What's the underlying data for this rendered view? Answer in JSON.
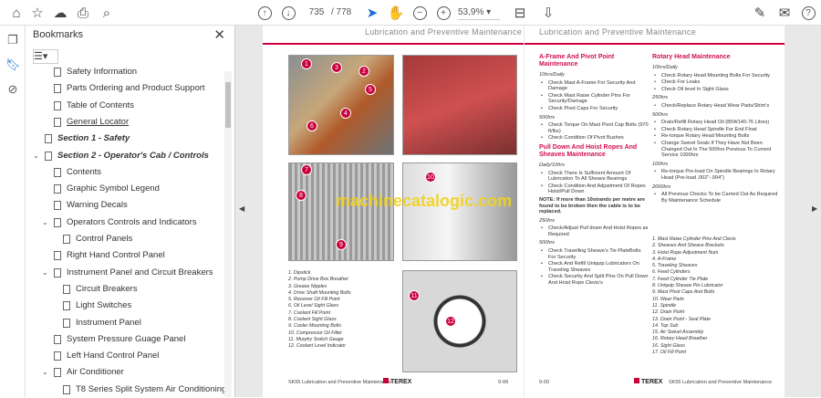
{
  "toolbar": {
    "current_page": "735",
    "total_pages": "/ 778",
    "zoom": "53,9%"
  },
  "bookmarks": {
    "title": "Bookmarks",
    "items": [
      {
        "label": "Safety Information",
        "level": 2,
        "bold": false,
        "twisty": ""
      },
      {
        "label": "Parts Ordering and Product Support",
        "level": 2,
        "bold": false,
        "twisty": ""
      },
      {
        "label": "Table of Contents",
        "level": 2,
        "bold": false,
        "twisty": ""
      },
      {
        "label": "General Locator",
        "level": 2,
        "bold": false,
        "twisty": ""
      },
      {
        "label": "Section 1 - Safety",
        "level": 1,
        "bold": true,
        "twisty": ""
      },
      {
        "label": "Section 2 - Operator's Cab / Controls",
        "level": 1,
        "bold": true,
        "twisty": "⌄"
      },
      {
        "label": "Contents",
        "level": 2,
        "bold": false,
        "twisty": ""
      },
      {
        "label": "Graphic Symbol Legend",
        "level": 2,
        "bold": false,
        "twisty": ""
      },
      {
        "label": "Warning Decals",
        "level": 2,
        "bold": false,
        "twisty": ""
      },
      {
        "label": "Operators Controls and Indicators",
        "level": 2,
        "bold": false,
        "twisty": "⌄"
      },
      {
        "label": "Control Panels",
        "level": 3,
        "bold": false,
        "twisty": ""
      },
      {
        "label": "Right Hand Control Panel",
        "level": 2,
        "bold": false,
        "twisty": ""
      },
      {
        "label": "Instrument Panel and Circuit Breakers",
        "level": 2,
        "bold": false,
        "twisty": "⌄"
      },
      {
        "label": "Circuit Breakers",
        "level": 3,
        "bold": false,
        "twisty": ""
      },
      {
        "label": "Light Switches",
        "level": 3,
        "bold": false,
        "twisty": ""
      },
      {
        "label": "Instrument Panel",
        "level": 3,
        "bold": false,
        "twisty": ""
      },
      {
        "label": "System Pressure Guage Panel",
        "level": 2,
        "bold": false,
        "twisty": ""
      },
      {
        "label": "Left Hand Control Panel",
        "level": 2,
        "bold": false,
        "twisty": ""
      },
      {
        "label": "Air Conditioner",
        "level": 2,
        "bold": false,
        "twisty": "⌄"
      },
      {
        "label": "T8 Series Split System Air Conditioning",
        "level": 3,
        "bold": false,
        "twisty": ""
      }
    ]
  },
  "left_page": {
    "header": "Lubrication and Preventive Maintenance",
    "watermark": "machinecatalogic.com",
    "callouts": [
      "1",
      "2",
      "3",
      "4",
      "5",
      "6",
      "7",
      "8",
      "9",
      "10",
      "11",
      "12"
    ],
    "legend": [
      "1. Dipstick",
      "2. Pump Drive Box Breather",
      "3. Grease Nipples",
      "4. Drive Shaft Mounting Bolts",
      "5. Receiver Oil Fill Point",
      "6. Oil Level Sight Glass",
      "7. Coolant Fill Point",
      "8. Coolant Sight Glass",
      "9. Cooler Mounting Bolts",
      "10. Compressor Oil Filter",
      "11. Murphy Switch Gauge",
      "12. Coolant Level Indicator"
    ],
    "footer": "SK55 Lubrication and Preventive Maintenance",
    "brand": "TEREX",
    "page_no": "9-99"
  },
  "right_page": {
    "header": "Lubrication and Preventive Maintenance",
    "sections": [
      {
        "title": "A-Frame And Pivot Point Maintenance",
        "groups": [
          {
            "interval": "10hrs/Daily",
            "items": [
              "Check Mast A-Frame For Security And Damage",
              "Check Mast Raise Cylinder Pins For Security/Damage",
              "Check Pivot Caps For Security"
            ]
          },
          {
            "interval": "500hrs",
            "items": [
              "Check Torque On Mast Pivot Cap Bolts (970 ft/lbs)",
              "Check Condition Of Pivot Bushes"
            ]
          }
        ]
      },
      {
        "title": "Pull Down And Hoist Ropes And Sheaves Maintenance",
        "groups": [
          {
            "interval": "Daily/10hrs",
            "items": [
              "Check There Is Sufficient Amount Of Lubrication To All Sheave Bearings",
              "Check Condition And Adjustment Of Ropes Hoist/Pull Down"
            ]
          }
        ],
        "note": "NOTE: If more than 10strands per metre are found to be broken then the cable is to be replaced.",
        "groups2": [
          {
            "interval": "250hrs",
            "items": [
              "Check/Adjust Pull down And Hoist Ropes as Required"
            ]
          },
          {
            "interval": "500hrs",
            "items": [
              "Check Travelling Sheave's Tie PlateBolts For Security",
              "Check And Refill Uniquip Lubricators On Traveling Sheaves",
              "Check Security And Split Pins On Pull Down And Hoist Rope Clevis's"
            ]
          }
        ]
      },
      {
        "title": "Rotary Head Maintenance",
        "groups": [
          {
            "interval": "10hrs/Daily",
            "items": [
              "Check Rotary Head Mounting Bolts For Security",
              "Check For Leaks",
              "Check Oil level In Sight Glass"
            ]
          },
          {
            "interval": "250hrs",
            "items": [
              "Check/Replace Rotary Head Wear Pads/Shim's"
            ]
          },
          {
            "interval": "500hrs",
            "items": [
              "Drain/Refill Rotary Head Oil (85W140-76 Litres)",
              "Check Rotary Head Spindle For End Float",
              "Re-torque Rotary Head Mounting Bolts",
              "Change Swivel Seals If They Have Not Been Changed Out In The 500hrs Previous To Current Service 1000hrs"
            ]
          },
          {
            "interval": "100hrs",
            "items": [
              "Re-torque Pre-load On Spindle Bearings In Rotary Head (Pre-load .002\"-.004\")"
            ]
          },
          {
            "interval": "2000hrs",
            "items": [
              "All Previous Checks To be Carried Out As Required By Maintenance Schedule"
            ]
          }
        ]
      }
    ],
    "legend": [
      "1. Mast Raise Cylinder Pins And Clevis",
      "2. Sheaves And Sheave Brackets",
      "3. Hoist Rope Adjustment Nuts",
      "4. A-Frame",
      "5. Traveling Sheaves",
      "6. Feed Cylinders",
      "7. Feed Cylinder Tie Plate",
      "8. Uniquip Sheave Pin Lubricator",
      "9. Mast Pivot Caps And Bolts",
      "10. Wear Pads",
      "11. Spindle",
      "12. Drain Point",
      "13. Drain Point - Seal Plate",
      "14. Top Sub",
      "15. Air Swivel Assembly",
      "16. Rotary Head Breather",
      "16. Sight Glass",
      "17. Oil Fill Point"
    ],
    "footer": "SK55 Lubrication and Preventive Maintenance",
    "brand": "TEREX",
    "page_no": "9-00"
  }
}
